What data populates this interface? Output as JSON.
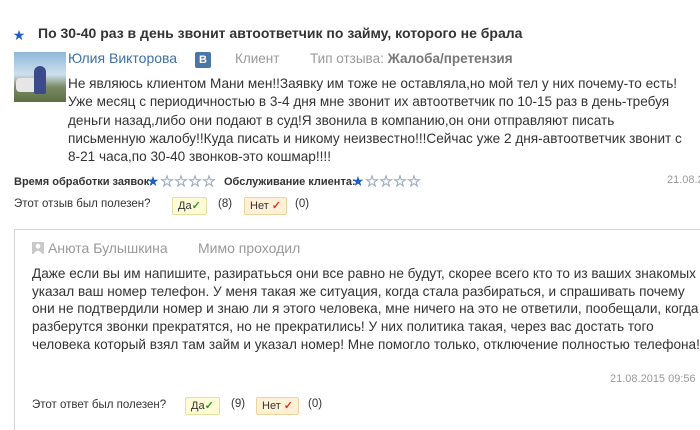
{
  "review": {
    "rating": 1,
    "rating_max": 5,
    "title": "По 30-40 раз в день звонит автоответчик по займу, которого не брала",
    "author": "Юлия Викторова",
    "vk_label": "В",
    "author_type": "Клиент",
    "type_label": "Тип отзыва:",
    "type_value": "Жалоба/претензия",
    "text": "Не являюсь клиентом Мани мен!!Заявку им тоже не оставляла,но мой тел у них почему-то есть!Уже месяц с периодичностью в 3-4 дня мне звонит их автоответчик по 10-15 раз в день-требуя деньги назад,либо они подают в суд!Я звонила в компанию,он они отправляют писать письменную жалобу!!Куда писать и никому неизвестно!!!Сейчас уже 2 дня-автоответчик звонит с 8-21 часа,по 30-40 звонков-это кошмар!!!!",
    "processing_label": "Время обработки заявок:",
    "processing_rating": 1,
    "service_label": "Обслуживание клиента:",
    "service_rating": 1,
    "date": "21.08.2",
    "useful_label": "Этот отзыв был полезен?",
    "yes_label": "Да",
    "yes_count": "(8)",
    "no_label": "Нет",
    "no_count": "(0)"
  },
  "reply": {
    "author": "Анюта Булышкина",
    "status": "Мимо проходил",
    "text": "Даже если вы им напишите, разиратьься они все равно не будут, скорее всего кто то из ваших знакомых указал ваш номер телефон. У меня такая же ситуация, когда стала разбираться, и спрашивать почему они не подтвердили номер и знаю ли я этого человека, мне ничего на это не ответили, пообещали, когда разберутся звонки прекратятся, но не прекратились! У них политика такая, через вас достать того человека который взял там займ и указал номер! Мне помогло только, отключение полностью телефона!",
    "date": "21.08.2015 09:56",
    "useful_label": "Этот ответ был полезен?",
    "yes_label": "Да",
    "yes_count": "(9)",
    "no_label": "Нет",
    "no_count": "(0)"
  },
  "icons": {
    "star": "star-icon",
    "check": "check-icon",
    "user": "user-icon",
    "vk": "vk-icon"
  },
  "colors": {
    "star_on": "#1f5fbf",
    "author_link": "#3f70a8",
    "yes_check": "#2b9a2b",
    "no_check": "#dd3333"
  }
}
